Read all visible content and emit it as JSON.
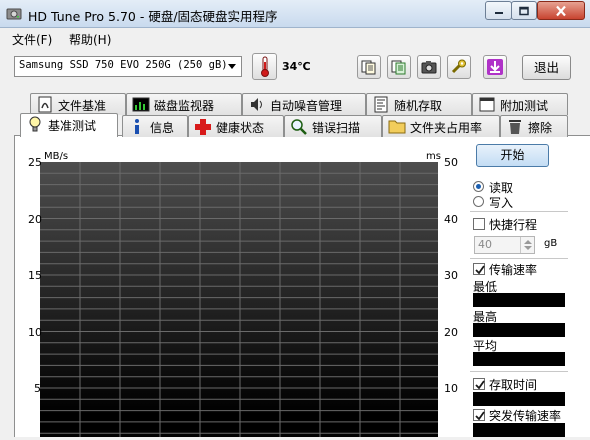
{
  "window": {
    "title": "HD Tune Pro 5.70 - 硬盘/固态硬盘实用程序"
  },
  "menu": {
    "file": "文件(F)",
    "help": "帮助(H)"
  },
  "toolbar": {
    "drive": "Samsung SSD 750 EVO 250G (250 gB)",
    "temperature": "34℃",
    "buttons": [
      "copy-text-icon",
      "copy-info-icon",
      "screenshot-camera-icon",
      "options-icon",
      "download-icon"
    ],
    "exit": "退出"
  },
  "tabs": {
    "row1": [
      "文件基准",
      "磁盘监视器",
      "自动噪音管理",
      "随机存取",
      "附加测试"
    ],
    "row2": [
      "基准测试",
      "信息",
      "健康状态",
      "错误扫描",
      "文件夹占用率",
      "擦除"
    ],
    "active": "基准测试"
  },
  "chart_data": {
    "type": "line",
    "left_axis_unit": "MB/s",
    "right_axis_unit": "ms",
    "left_ticks": [
      "25",
      "20",
      "15",
      "10",
      "5"
    ],
    "right_ticks": [
      "50",
      "40",
      "30",
      "20",
      "10"
    ],
    "grid": true,
    "series": []
  },
  "panel": {
    "start": "开始",
    "read": "读取",
    "write": "写入",
    "short_stroke": "快捷行程",
    "short_stroke_value": "40",
    "short_stroke_unit": "gB",
    "transfer_rate": "传输速率",
    "minimum": "最低",
    "maximum": "最高",
    "average": "平均",
    "access_time": "存取时间",
    "burst_rate": "突发传输速率"
  }
}
